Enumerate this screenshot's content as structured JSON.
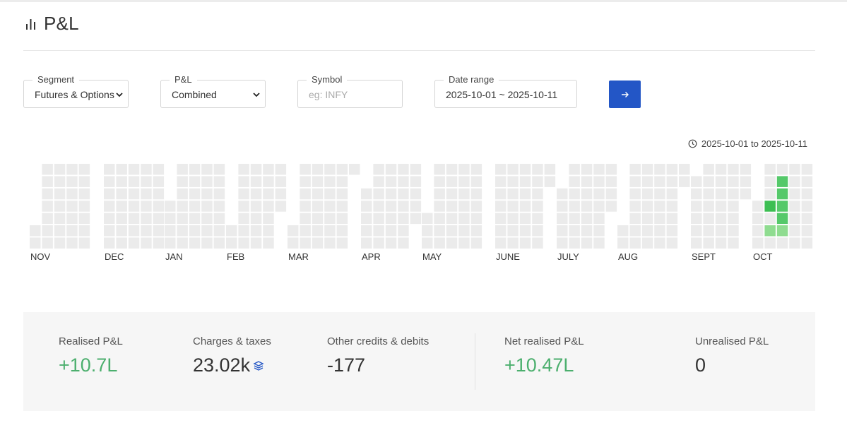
{
  "header": {
    "title": "P&L",
    "icon": "bar-chart-icon"
  },
  "filters": {
    "segment": {
      "label": "Segment",
      "value": "Futures & Options"
    },
    "pnl": {
      "label": "P&L",
      "value": "Combined"
    },
    "symbol": {
      "label": "Symbol",
      "placeholder": "eg: INFY",
      "value": ""
    },
    "date_range": {
      "label": "Date range",
      "value": "2025-10-01 ~ 2025-10-11"
    },
    "submit": {
      "icon": "arrow-right-icon"
    }
  },
  "range_note": {
    "icon": "clock-icon",
    "text": "2025-10-01 to 2025-10-11"
  },
  "heatmap": {
    "months": [
      "NOV",
      "DEC",
      "JAN",
      "FEB",
      "MAR",
      "APR",
      "MAY",
      "JUNE",
      "JULY",
      "AUG",
      "SEPT",
      "OCT"
    ],
    "highlighted_days": [
      {
        "month": "OCT",
        "week": 1,
        "weekday": 3,
        "shade": "dark"
      },
      {
        "month": "OCT",
        "week": 1,
        "weekday": 5,
        "shade": "light"
      },
      {
        "month": "OCT",
        "week": 2,
        "weekday": 1,
        "shade": "medium"
      },
      {
        "month": "OCT",
        "week": 2,
        "weekday": 2,
        "shade": "medium"
      },
      {
        "month": "OCT",
        "week": 2,
        "weekday": 3,
        "shade": "medium"
      },
      {
        "month": "OCT",
        "week": 2,
        "weekday": 4,
        "shade": "medium"
      },
      {
        "month": "OCT",
        "week": 2,
        "weekday": 5,
        "shade": "light"
      }
    ]
  },
  "summary": {
    "realised": {
      "label": "Realised P&L",
      "value": "+10.7L"
    },
    "charges": {
      "label": "Charges & taxes",
      "value": "23.02k",
      "icon": "layers-icon"
    },
    "other": {
      "label": "Other credits & debits",
      "value": "-177"
    },
    "net": {
      "label": "Net realised P&L",
      "value": "+10.47L"
    },
    "unrealised": {
      "label": "Unrealised P&L",
      "value": "0"
    }
  },
  "colors": {
    "accent": "#2356c6",
    "positive": "#4caf6e",
    "cell_empty": "#ebebeb",
    "cell_dark": "#3cbe52",
    "cell_medium": "#55c96a",
    "cell_light": "#8fdc90"
  }
}
